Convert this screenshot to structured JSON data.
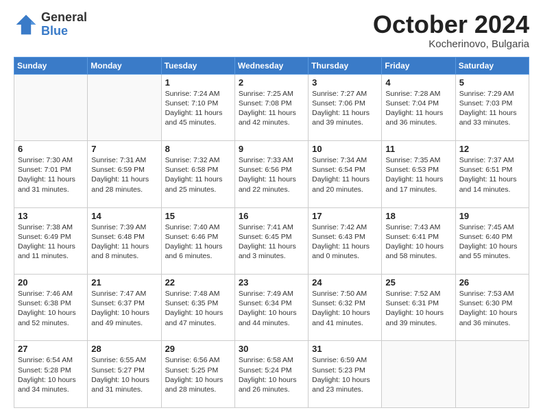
{
  "logo": {
    "general": "General",
    "blue": "Blue"
  },
  "header": {
    "title": "October 2024",
    "subtitle": "Kocherinovo, Bulgaria"
  },
  "weekdays": [
    "Sunday",
    "Monday",
    "Tuesday",
    "Wednesday",
    "Thursday",
    "Friday",
    "Saturday"
  ],
  "weeks": [
    [
      {
        "day": "",
        "info": ""
      },
      {
        "day": "",
        "info": ""
      },
      {
        "day": "1",
        "info": "Sunrise: 7:24 AM\nSunset: 7:10 PM\nDaylight: 11 hours\nand 45 minutes."
      },
      {
        "day": "2",
        "info": "Sunrise: 7:25 AM\nSunset: 7:08 PM\nDaylight: 11 hours\nand 42 minutes."
      },
      {
        "day": "3",
        "info": "Sunrise: 7:27 AM\nSunset: 7:06 PM\nDaylight: 11 hours\nand 39 minutes."
      },
      {
        "day": "4",
        "info": "Sunrise: 7:28 AM\nSunset: 7:04 PM\nDaylight: 11 hours\nand 36 minutes."
      },
      {
        "day": "5",
        "info": "Sunrise: 7:29 AM\nSunset: 7:03 PM\nDaylight: 11 hours\nand 33 minutes."
      }
    ],
    [
      {
        "day": "6",
        "info": "Sunrise: 7:30 AM\nSunset: 7:01 PM\nDaylight: 11 hours\nand 31 minutes."
      },
      {
        "day": "7",
        "info": "Sunrise: 7:31 AM\nSunset: 6:59 PM\nDaylight: 11 hours\nand 28 minutes."
      },
      {
        "day": "8",
        "info": "Sunrise: 7:32 AM\nSunset: 6:58 PM\nDaylight: 11 hours\nand 25 minutes."
      },
      {
        "day": "9",
        "info": "Sunrise: 7:33 AM\nSunset: 6:56 PM\nDaylight: 11 hours\nand 22 minutes."
      },
      {
        "day": "10",
        "info": "Sunrise: 7:34 AM\nSunset: 6:54 PM\nDaylight: 11 hours\nand 20 minutes."
      },
      {
        "day": "11",
        "info": "Sunrise: 7:35 AM\nSunset: 6:53 PM\nDaylight: 11 hours\nand 17 minutes."
      },
      {
        "day": "12",
        "info": "Sunrise: 7:37 AM\nSunset: 6:51 PM\nDaylight: 11 hours\nand 14 minutes."
      }
    ],
    [
      {
        "day": "13",
        "info": "Sunrise: 7:38 AM\nSunset: 6:49 PM\nDaylight: 11 hours\nand 11 minutes."
      },
      {
        "day": "14",
        "info": "Sunrise: 7:39 AM\nSunset: 6:48 PM\nDaylight: 11 hours\nand 8 minutes."
      },
      {
        "day": "15",
        "info": "Sunrise: 7:40 AM\nSunset: 6:46 PM\nDaylight: 11 hours\nand 6 minutes."
      },
      {
        "day": "16",
        "info": "Sunrise: 7:41 AM\nSunset: 6:45 PM\nDaylight: 11 hours\nand 3 minutes."
      },
      {
        "day": "17",
        "info": "Sunrise: 7:42 AM\nSunset: 6:43 PM\nDaylight: 11 hours\nand 0 minutes."
      },
      {
        "day": "18",
        "info": "Sunrise: 7:43 AM\nSunset: 6:41 PM\nDaylight: 10 hours\nand 58 minutes."
      },
      {
        "day": "19",
        "info": "Sunrise: 7:45 AM\nSunset: 6:40 PM\nDaylight: 10 hours\nand 55 minutes."
      }
    ],
    [
      {
        "day": "20",
        "info": "Sunrise: 7:46 AM\nSunset: 6:38 PM\nDaylight: 10 hours\nand 52 minutes."
      },
      {
        "day": "21",
        "info": "Sunrise: 7:47 AM\nSunset: 6:37 PM\nDaylight: 10 hours\nand 49 minutes."
      },
      {
        "day": "22",
        "info": "Sunrise: 7:48 AM\nSunset: 6:35 PM\nDaylight: 10 hours\nand 47 minutes."
      },
      {
        "day": "23",
        "info": "Sunrise: 7:49 AM\nSunset: 6:34 PM\nDaylight: 10 hours\nand 44 minutes."
      },
      {
        "day": "24",
        "info": "Sunrise: 7:50 AM\nSunset: 6:32 PM\nDaylight: 10 hours\nand 41 minutes."
      },
      {
        "day": "25",
        "info": "Sunrise: 7:52 AM\nSunset: 6:31 PM\nDaylight: 10 hours\nand 39 minutes."
      },
      {
        "day": "26",
        "info": "Sunrise: 7:53 AM\nSunset: 6:30 PM\nDaylight: 10 hours\nand 36 minutes."
      }
    ],
    [
      {
        "day": "27",
        "info": "Sunrise: 6:54 AM\nSunset: 5:28 PM\nDaylight: 10 hours\nand 34 minutes."
      },
      {
        "day": "28",
        "info": "Sunrise: 6:55 AM\nSunset: 5:27 PM\nDaylight: 10 hours\nand 31 minutes."
      },
      {
        "day": "29",
        "info": "Sunrise: 6:56 AM\nSunset: 5:25 PM\nDaylight: 10 hours\nand 28 minutes."
      },
      {
        "day": "30",
        "info": "Sunrise: 6:58 AM\nSunset: 5:24 PM\nDaylight: 10 hours\nand 26 minutes."
      },
      {
        "day": "31",
        "info": "Sunrise: 6:59 AM\nSunset: 5:23 PM\nDaylight: 10 hours\nand 23 minutes."
      },
      {
        "day": "",
        "info": ""
      },
      {
        "day": "",
        "info": ""
      }
    ]
  ]
}
